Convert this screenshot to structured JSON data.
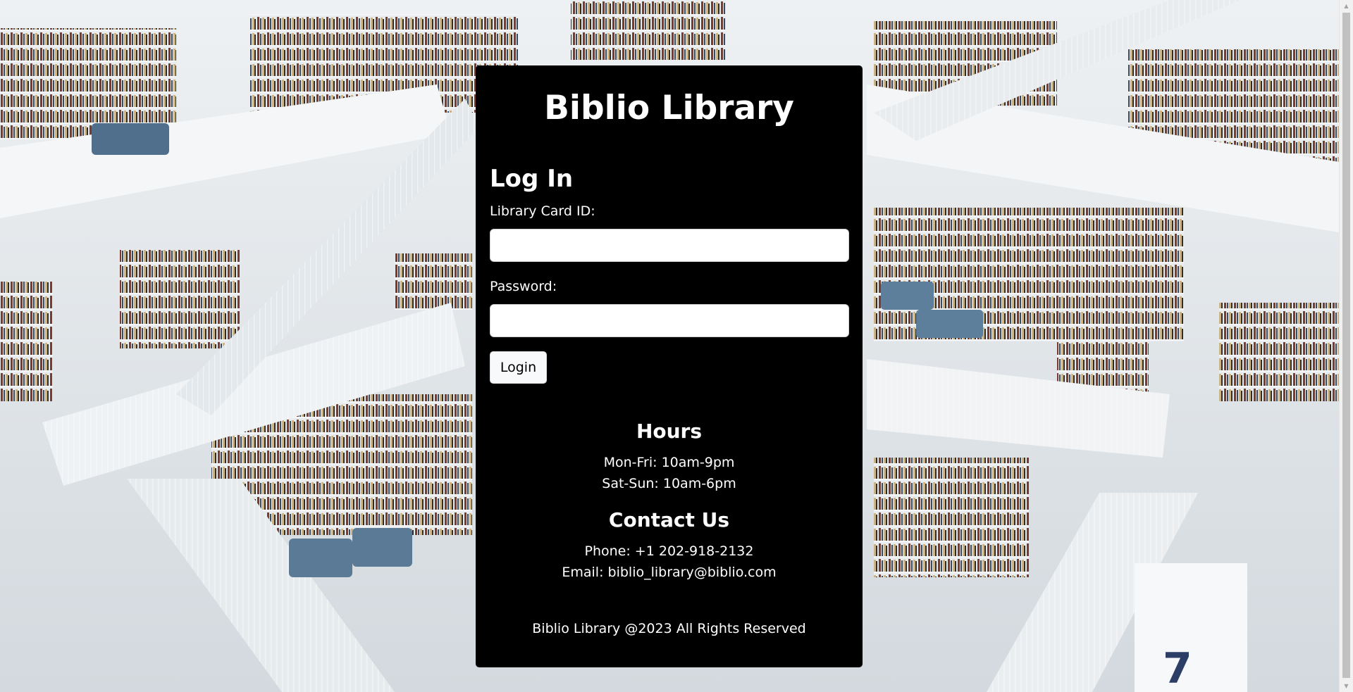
{
  "site": {
    "title": "Biblio Library"
  },
  "login": {
    "heading": "Log In",
    "card_id_label": "Library Card ID:",
    "card_id_value": "",
    "password_label": "Password:",
    "password_value": "",
    "button_label": "Login"
  },
  "hours": {
    "heading": "Hours",
    "weekday": "Mon-Fri: 10am-9pm",
    "weekend": "Sat-Sun: 10am-6pm"
  },
  "contact": {
    "heading": "Contact Us",
    "phone": "Phone: +1 202-918-2132",
    "email": "Email: biblio_library@biblio.com"
  },
  "footer": {
    "text": "Biblio Library @2023 All Rights Reserved"
  },
  "colors": {
    "panel_background": "#000000",
    "panel_text": "#ffffff",
    "button_background": "#f8f9fa"
  },
  "scrollbar": {
    "up_icon": "scroll-up-arrow-icon",
    "down_icon": "scroll-down-arrow-icon"
  }
}
